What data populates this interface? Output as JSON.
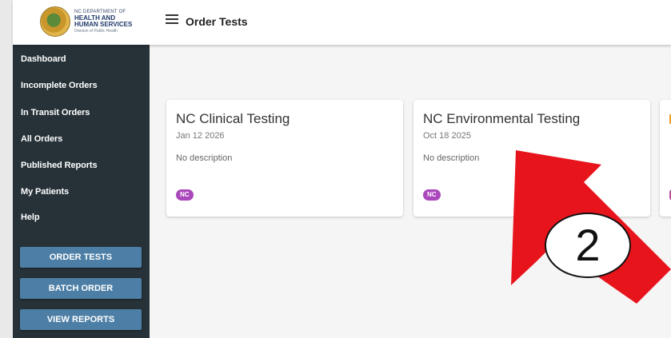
{
  "header": {
    "logo": {
      "line1": "NC DEPARTMENT OF",
      "line2": "HEALTH AND",
      "line3": "HUMAN SERVICES",
      "line4": "Division of Public Health"
    },
    "menu_icon": "hamburger-menu-icon",
    "title": "Order Tests"
  },
  "sidebar": {
    "items": [
      {
        "label": "Dashboard"
      },
      {
        "label": "Incomplete Orders"
      },
      {
        "label": "In Transit Orders"
      },
      {
        "label": "All Orders"
      },
      {
        "label": "Published Reports"
      },
      {
        "label": "My Patients"
      },
      {
        "label": "Help"
      }
    ],
    "buttons": [
      {
        "label": "ORDER TESTS"
      },
      {
        "label": "BATCH ORDER"
      },
      {
        "label": "VIEW REPORTS"
      }
    ]
  },
  "cards": [
    {
      "title": "NC Clinical Testing",
      "date": "Jan 12 2026",
      "description": "No description",
      "chip": "NC"
    },
    {
      "title": "NC Environmental Testing",
      "date": "Oct 18 2025",
      "description": "No description",
      "chip": "NC"
    }
  ],
  "annotation": {
    "number": "2",
    "arrow_color": "#e8141c"
  },
  "colors": {
    "sidebar": "#263238",
    "button": "#4d7fa6",
    "chip": "#ab47bc"
  }
}
